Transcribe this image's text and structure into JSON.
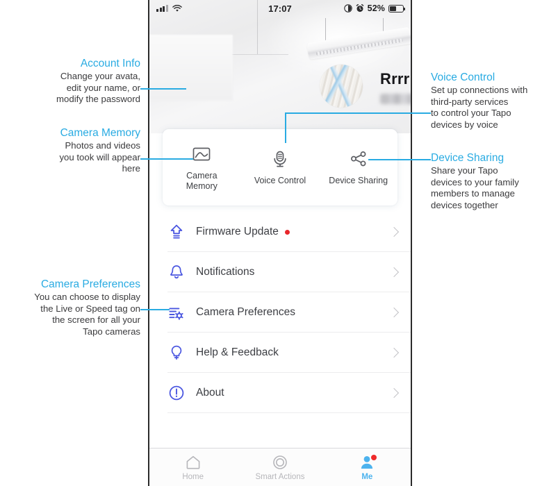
{
  "phone": {
    "status_bar": {
      "signal_icon": "signal-bars-icon",
      "wifi_icon": "wifi-icon",
      "time": "17:07",
      "lock_rotation_icon": "rotation-lock-icon",
      "alarm_icon": "alarm-clock-icon",
      "battery_percent": "52%",
      "battery_icon": "battery-icon",
      "battery_level": 52
    },
    "profile": {
      "avatar_icon": "user-avatar-photo",
      "name": "Rrrr",
      "email": "",
      "email_state": "blurred"
    },
    "quick_actions": [
      {
        "icon": "photo-image-icon",
        "label": "Camera\nMemory",
        "line1": "Camera",
        "line2": "Memory"
      },
      {
        "icon": "microphone-icon",
        "label": "Voice Control",
        "line1": "Voice Control",
        "line2": ""
      },
      {
        "icon": "share-nodes-icon",
        "label": "Device Sharing",
        "line1": "Device Sharing",
        "line2": ""
      }
    ],
    "menu_items": [
      {
        "icon": "firmware-upload-icon",
        "label": "Firmware Update",
        "badge": true,
        "chevron": "chevron-right-icon"
      },
      {
        "icon": "bell-icon",
        "label": "Notifications",
        "badge": false,
        "chevron": "chevron-right-icon"
      },
      {
        "icon": "sliders-gear-icon",
        "label": "Camera Preferences",
        "badge": false,
        "chevron": "chevron-right-icon"
      },
      {
        "icon": "lightbulb-icon",
        "label": "Help & Feedback",
        "badge": false,
        "chevron": "chevron-right-icon"
      },
      {
        "icon": "info-circle-icon",
        "label": "About",
        "badge": false,
        "chevron": "chevron-right-icon"
      }
    ],
    "tab_bar": [
      {
        "icon": "home-icon",
        "label": "Home",
        "active": false,
        "badge": false
      },
      {
        "icon": "smart-actions-icon",
        "label": "Smart Actions",
        "active": false,
        "badge": false
      },
      {
        "icon": "person-icon",
        "label": "Me",
        "active": true,
        "badge": true
      }
    ]
  },
  "annotations": {
    "account_info": {
      "title": "Account Info",
      "body": "Change your avata,\nedit your name, or\nmodify the password"
    },
    "camera_memory": {
      "title": "Camera Memory",
      "body": "Photos and videos\nyou took will appear\nhere"
    },
    "camera_preferences": {
      "title": "Camera Preferences",
      "body": "You can choose to display\nthe Live or Speed tag on\nthe screen for all your\nTapo cameras"
    },
    "voice_control": {
      "title": "Voice Control",
      "body": "Set up connections with\nthird-party services\nto control your Tapo\ndevices by voice"
    },
    "device_sharing": {
      "title": "Device Sharing",
      "body": "Share your Tapo\ndevices to your family\nmembers to manage\ndevices together"
    }
  },
  "colors": {
    "annotation_accent": "#29abe2",
    "menu_icon": "#4a56e0",
    "badge_red": "#e8262b",
    "tab_active": "#4db3ee"
  }
}
